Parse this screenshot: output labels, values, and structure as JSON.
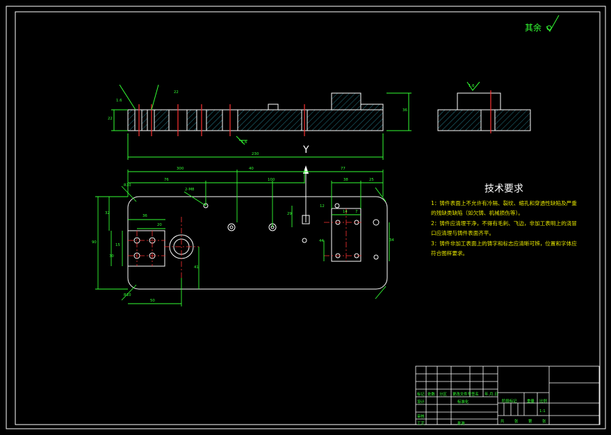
{
  "roughness_note": "其余",
  "view_marker": "Y",
  "technical_requirements": {
    "title": "技术要求",
    "items": [
      "1：铸件表面上不允许有冷隔、裂纹、缩孔和穿透性缺陷及严重的残缺类缺陷（如欠铸、机械损伤等）。",
      "2：铸件应清理干净，不得有毛刺、飞边，非加工表明上的浇冒口应清理与铸件表面齐平。",
      "3：铸件非加工表面上的铸字和标志应清晰可辨，位置和字体应符合图样要求。"
    ]
  },
  "dimensions": {
    "overall_length": "230",
    "height_front": "36",
    "height_left": "22",
    "plan_300": "300",
    "plan_40": "40",
    "plan_77": "77",
    "plan_76": "76",
    "plan_100": "100",
    "plan_38": "38",
    "plan_25": "25",
    "plan_90": "90",
    "plan_32": "32",
    "plan_36": "36",
    "plan_15": "15",
    "plan_20": "20",
    "plan_50": "50",
    "plan_41": "41",
    "plan_29": "29",
    "plan_14": "14",
    "plan_7": "7",
    "plan_12": "12",
    "plan_44": "44",
    "plan_34": "34",
    "plan_30": "30",
    "plan_22": "22",
    "radius_top": "R10",
    "radius_bottom": "R10",
    "hole_label": "2-M8",
    "roughness_a": "1.6",
    "roughness_b": "1.6",
    "roughness_c": "1.6"
  },
  "title_block": {
    "labels": [
      "标记",
      "处数",
      "分区",
      "更改文件号",
      "签名",
      "年.月.日",
      "设计",
      "标准化",
      "审核",
      "工艺",
      "批准",
      "阶段标记",
      "重量",
      "比例",
      "共",
      "张",
      "第",
      "张"
    ],
    "scale": "1:1"
  }
}
